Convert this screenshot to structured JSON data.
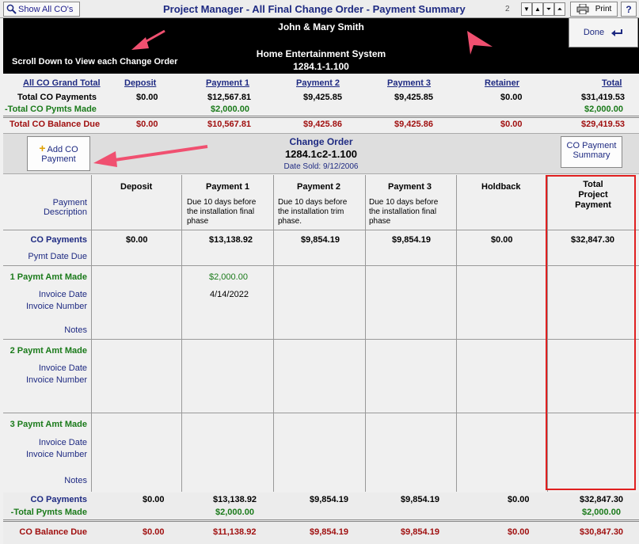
{
  "toolbar": {
    "show_all_label": "Show All CO's",
    "title": "Project Manager - All Final Change Order - Payment Summary",
    "page_count": "2",
    "print_label": "Print",
    "help_label": "?"
  },
  "header": {
    "client": "John & Mary Smith",
    "scroll_note": "Scroll Down to View each Change Order",
    "job_name": "Home Entertainment System",
    "job_number": "1284.1-1.100",
    "done_label": "Done"
  },
  "grand_total": {
    "headers": [
      "All CO Grand Total",
      "Deposit",
      "Payment 1",
      "Payment 2",
      "Payment 3",
      "Retainer",
      "Total"
    ],
    "total_payments_label": "Total CO Payments",
    "total_payments": [
      "$0.00",
      "$12,567.81",
      "$9,425.85",
      "$9,425.85",
      "$0.00",
      "$31,419.53"
    ],
    "pymts_made_label": "-Total CO Pymts Made",
    "pymts_made": [
      "$2,000.00",
      "$2,000.00"
    ],
    "balance_label": "Total CO Balance Due",
    "balance": [
      "$0.00",
      "$10,567.81",
      "$9,425.86",
      "$9,425.86",
      "$0.00",
      "$29,419.53"
    ]
  },
  "change_order": {
    "add_label_1": "Add CO",
    "add_label_2": "Payment",
    "title": "Change Order",
    "number": "1284.1c2-1.100",
    "date_sold": "Date Sold: 9/12/2006",
    "summary_label_1": "CO Payment",
    "summary_label_2": "Summary"
  },
  "grid": {
    "headers": [
      "Deposit",
      "Payment 1",
      "Payment 2",
      "Payment 3",
      "Holdback"
    ],
    "total_header": [
      "Total",
      "Project",
      "Payment"
    ],
    "payment_description_label": [
      "Payment",
      "Description"
    ],
    "descriptions": {
      "p1": [
        "Due 10 days before",
        "the installation final",
        "phase"
      ],
      "p2": [
        "Due 10 days before",
        "the installation trim",
        "phase."
      ],
      "p3": [
        "Due 10 days before",
        "the installation final",
        "phase"
      ]
    },
    "co_payments_label": "CO Payments",
    "pymt_date_due_label": "Pymt Date Due",
    "co_payments": [
      "$0.00",
      "$13,138.92",
      "$9,854.19",
      "$9,854.19",
      "$0.00",
      "$32,847.30"
    ],
    "rows": [
      {
        "title": "1 Paymt Amt Made",
        "invoice_date": "Invoice Date",
        "invoice_number": "Invoice Number",
        "notes": "Notes",
        "p1_amount": "$2,000.00",
        "p1_date": "4/14/2022"
      },
      {
        "title": "2 Paymt Amt Made",
        "invoice_date": "Invoice Date",
        "invoice_number": "Invoice Number",
        "notes": ""
      },
      {
        "title": "3 Paymt Amt Made",
        "invoice_date": "Invoice Date",
        "invoice_number": "Invoice Number",
        "notes": "Notes"
      }
    ]
  },
  "bottom": {
    "co_payments_label": "CO Payments",
    "co_payments": [
      "$0.00",
      "$13,138.92",
      "$9,854.19",
      "$9,854.19",
      "$0.00",
      "$32,847.30"
    ],
    "pymts_made_label": "-Total Pymts Made",
    "pymts_made": [
      "$2,000.00",
      "$2,000.00"
    ],
    "balance_label": "CO Balance Due",
    "balance": [
      "$0.00",
      "$11,138.92",
      "$9,854.19",
      "$9,854.19",
      "$0.00",
      "$30,847.30"
    ]
  },
  "colors": {
    "accent": "#1e2a82",
    "green": "#1a7a1a",
    "red": "#a01010",
    "highlight": "#e02020"
  }
}
